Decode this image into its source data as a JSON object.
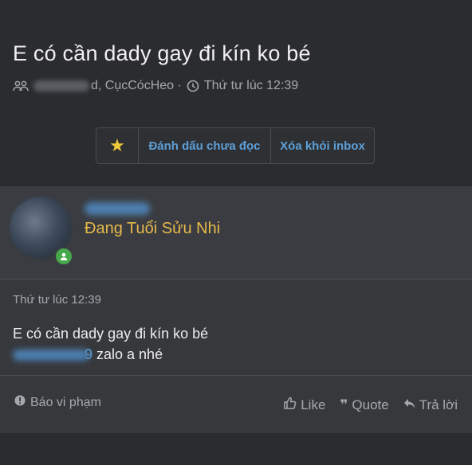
{
  "thread": {
    "title": "E có cần dady gay đi kín ko bé",
    "participants_suffix": "d, CụcCócHeo ·",
    "time": "Thứ tư lúc 12:39"
  },
  "actions": {
    "star_icon": "★",
    "mark_unread": "Đánh dấu chưa đọc",
    "remove_inbox": "Xóa khỏi inbox"
  },
  "message": {
    "user_title": "Đang Tuổi Sửu Nhi",
    "time": "Thứ tư lúc 12:39",
    "line1": "E có cần dady gay đi kín ko bé",
    "phone_tail": "9",
    "line2_rest": " zalo a nhé"
  },
  "footer": {
    "report": "Báo vi phạm",
    "like": "Like",
    "quote": "Quote",
    "reply": "Trả lời"
  },
  "colors": {
    "background": "#2b2c2f",
    "link": "#5d9fd6",
    "user_title": "#e6b94a",
    "online": "#46a84a"
  }
}
